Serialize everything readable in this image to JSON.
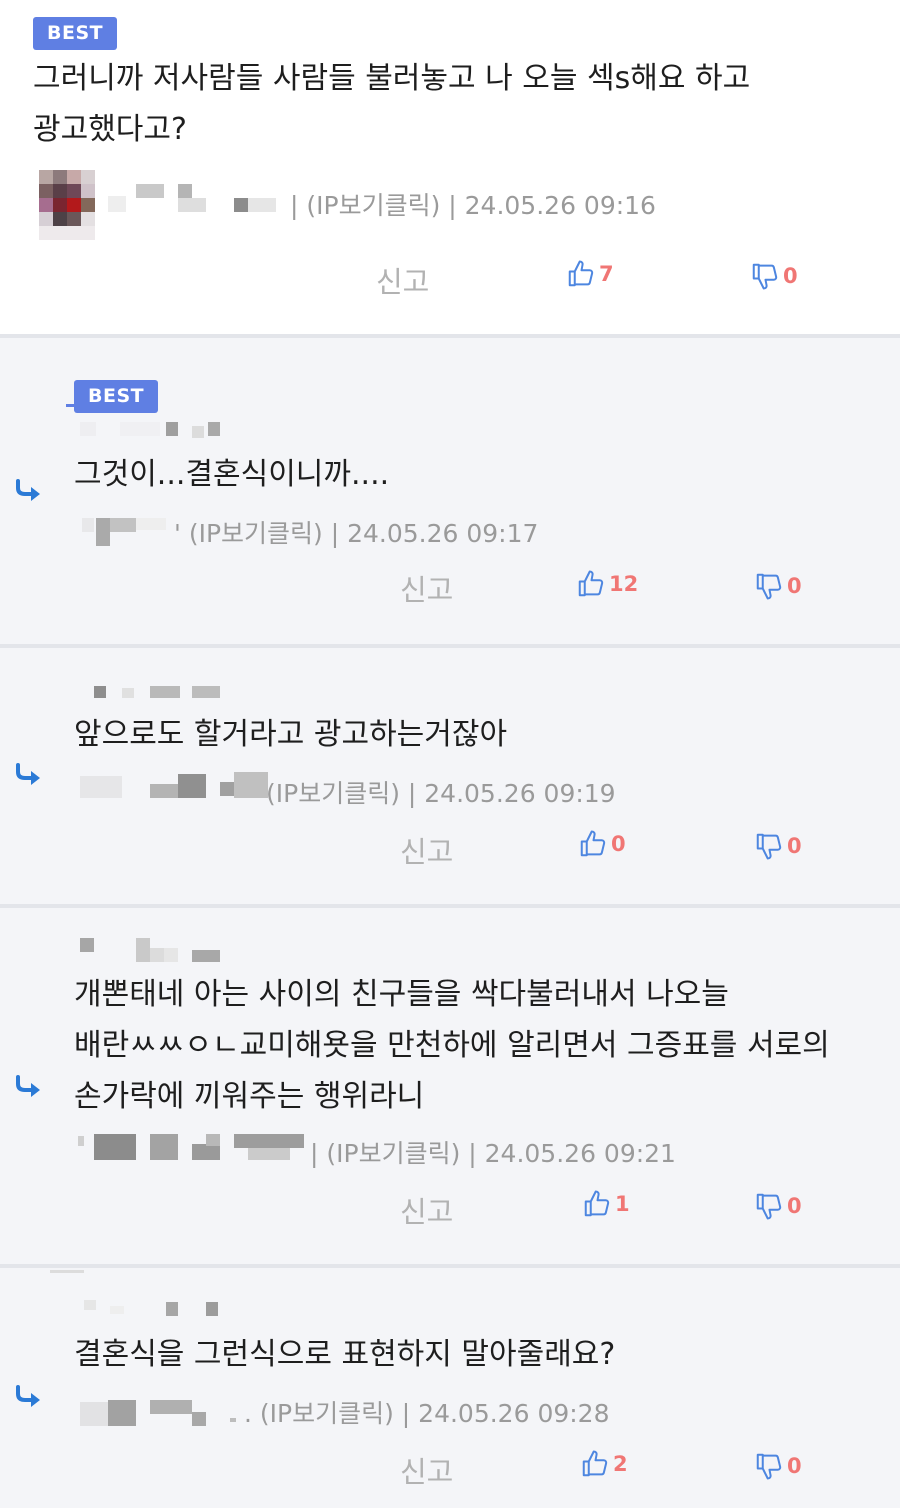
{
  "comments": [
    {
      "badge": "BEST",
      "text": "그러니까 저사람들 사람들 불러놓고 나 오늘 섹s해요 하고 광고했다고?",
      "meta": "| (IP보기클릭) | 24.05.26 09:16",
      "report": "신고",
      "likes": "7",
      "dislikes": "0"
    },
    {
      "badge": "BEST",
      "text": "그것이...결혼식이니까....",
      "meta": "' (IP보기클릭) | 24.05.26 09:17",
      "report": "신고",
      "likes": "12",
      "dislikes": "0"
    },
    {
      "text": "앞으로도 할거라고 광고하는거잖아",
      "meta": "(IP보기클릭) | 24.05.26 09:19",
      "report": "신고",
      "likes": "0",
      "dislikes": "0"
    },
    {
      "text": "개뽄태네 아는 사이의 친구들을 싹다불러내서 나오늘 배란ㅆㅆㅇㄴ교미해욧을 만천하에 알리면서 그증표를 서로의 손가락에 끼워주는 행위라니",
      "meta": "| (IP보기클릭) | 24.05.26 09:21",
      "report": "신고",
      "likes": "1",
      "dislikes": "0"
    },
    {
      "text": "결혼식을 그런식으로 표현하지 말아줄래요?",
      "meta": ". (IP보기클릭) | 24.05.26 09:28",
      "report": "신고",
      "likes": "2",
      "dislikes": "0"
    }
  ],
  "icons": {
    "like": "thumbs-up-icon",
    "dislike": "thumbs-down-icon",
    "reply": "reply-arrow-icon"
  },
  "colors": {
    "badge": "#5f7fe3",
    "icon_blue": "#4d86e0",
    "count_red": "#f07674",
    "reply_bg": "#f4f5f8",
    "divider": "#e3e5ea"
  }
}
